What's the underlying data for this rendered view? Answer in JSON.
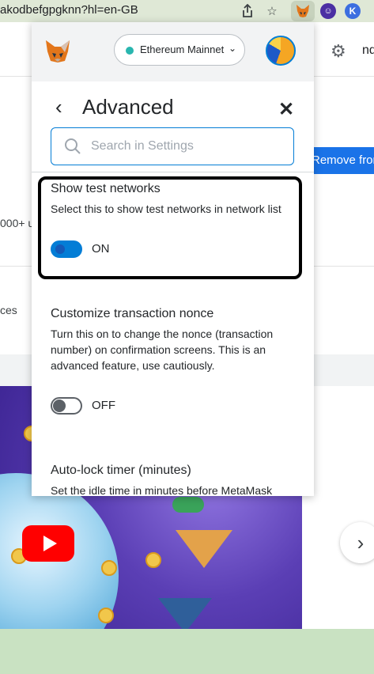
{
  "browser": {
    "url": "akodbefgpgknn?hl=en-GB",
    "share_icon": "share-icon",
    "bookmark_icon": "star-icon",
    "extensions": [
      "metamask-fox-icon",
      "purple-extension-icon",
      "k-extension-icon"
    ],
    "k_extension_letter": "K"
  },
  "background_page": {
    "right_button_label": "Remove fron",
    "header_text": "nd",
    "text_fragment_1": "000+ u",
    "text_fragment_2": "ces"
  },
  "metamask": {
    "network": {
      "name": "Ethereum Mainnet",
      "status_color": "#29b6af"
    },
    "title": "Advanced",
    "search": {
      "placeholder": "Search in Settings",
      "value": ""
    },
    "settings": [
      {
        "title": "Show test networks",
        "description": "Select this to show test networks in network list",
        "state": "ON",
        "enabled": true
      },
      {
        "title": "Customize transaction nonce",
        "description": "Turn this on to change the nonce (transaction number) on confirmation screens. This is an advanced feature, use cautiously.",
        "state": "OFF",
        "enabled": false
      },
      {
        "title": "Auto-lock timer (minutes)",
        "description": "Set the idle time in minutes before MetaMask"
      }
    ]
  },
  "colors": {
    "accent": "#037dd6",
    "browser_bar": "#dfe8d6",
    "highlight_border": "#000000"
  }
}
